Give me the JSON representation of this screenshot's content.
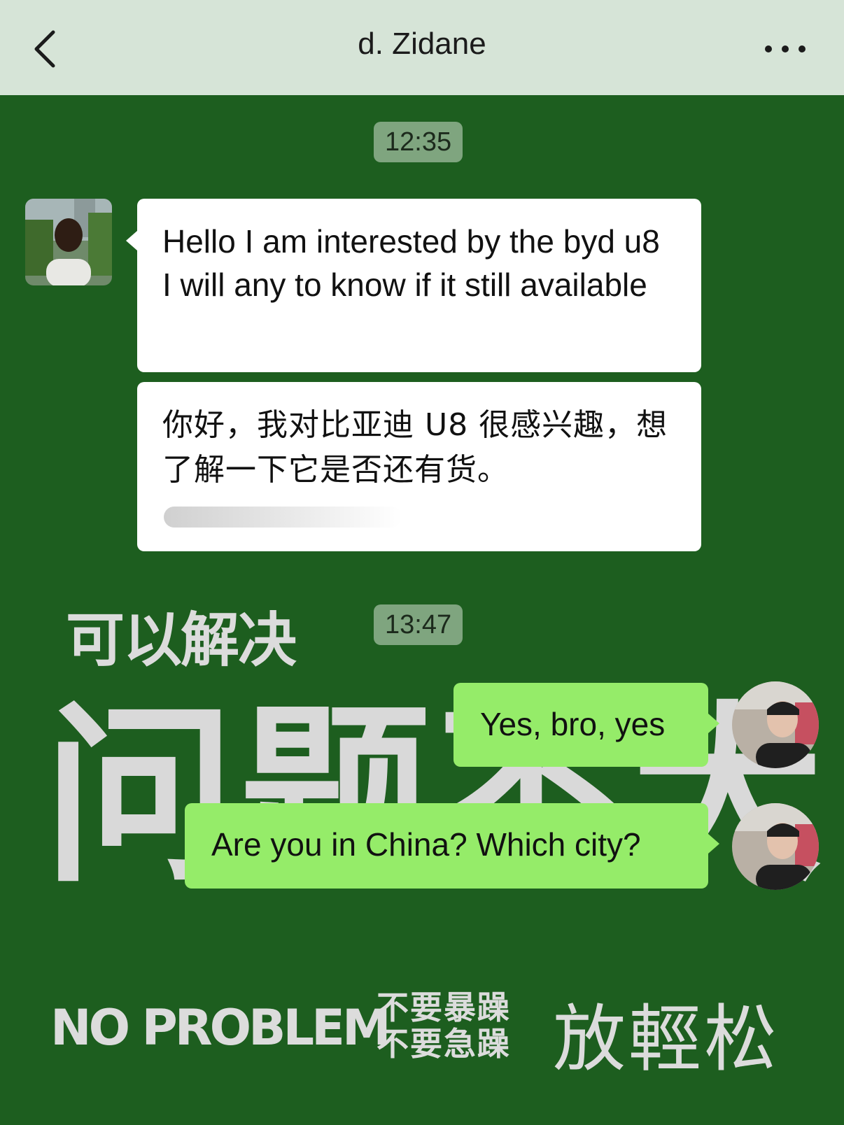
{
  "header": {
    "title": "d. Zidane",
    "back_icon": "chevron-left-icon",
    "more_icon": "more-dots-icon"
  },
  "messages": {
    "time_1": "12:35",
    "incoming_1": "Hello I am interested by the byd u8 I will any to know if it still available",
    "incoming_1_translation": "你好，我对比亚迪 U8 很感兴趣，想了解一下它是否还有货。",
    "time_2": "13:47",
    "outgoing_1": "Yes, bro, yes",
    "outgoing_2": "Are you in China? Which city?"
  },
  "wallpaper": {
    "line_1": "可以解决",
    "line_2": "问题不大",
    "line_3": "NO PROBLEM",
    "line_4a": "不要暴躁",
    "line_4b": "不要急躁",
    "line_5": "放輕松"
  },
  "colors": {
    "background": "#1d5e1f",
    "header": "#d6e4d7",
    "outgoing_bubble": "#95ec69",
    "incoming_bubble": "#ffffff",
    "time_pill": "#7fa57f"
  }
}
